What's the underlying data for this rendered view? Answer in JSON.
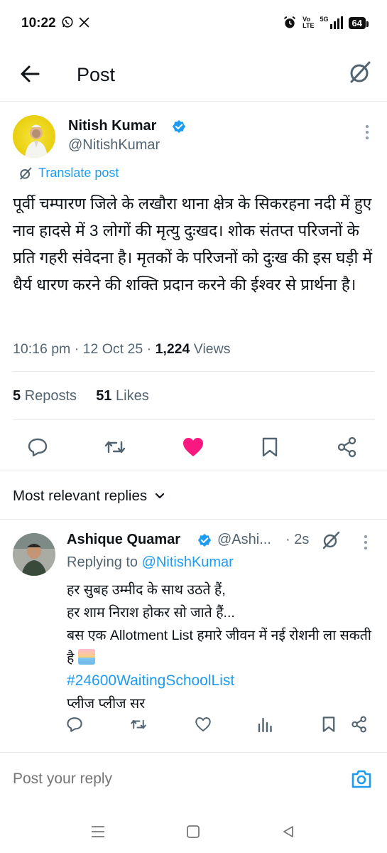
{
  "status_bar": {
    "time": "10:22",
    "left_icons": [
      "whatsapp-icon",
      "x-logo-icon"
    ],
    "network_top": "Vo",
    "network_bottom": "LTE",
    "signal": "5G",
    "battery": "64"
  },
  "header": {
    "title": "Post",
    "back_icon": "arrow-left-icon",
    "grok_icon": "grok-icon"
  },
  "post": {
    "author_name": "Nitish Kumar",
    "author_handle": "@NitishKumar",
    "translate_label": "Translate post",
    "text": "पूर्वी चम्पारण जिले के लखौरा थाना क्षेत्र के सिकरहना नदी में हुए नाव हादसे में 3 लोगों की मृत्यु दुःखद। शोक संतप्त परिजनों के प्रति गहरी संवेदना है। मृतकों के परिजनों को दुःख की इस घड़ी में धैर्य धारण करने की शक्ति प्रदान करने की ईश्वर से प्रार्थना है।",
    "time": "10:16 pm",
    "date": "12 Oct 25",
    "views_count": "1,224",
    "views_label": "Views",
    "reposts_count": "5",
    "reposts_label": "Reposts",
    "likes_count": "51",
    "likes_label": "Likes",
    "like_color": "#f91880"
  },
  "replies_section": {
    "sort_label": "Most relevant replies"
  },
  "reply": {
    "author_name": "Ashique Quamar",
    "author_handle": "@Ashi...",
    "time": "· 2s",
    "replying_prefix": "Replying to",
    "replying_handle": "@NitishKumar",
    "line1": "हर सुबह उम्मीद के साथ उठते हैं,",
    "line2": "हर शाम निराश होकर सो जाते हैं...",
    "line3": "बस एक Allotment List हमारे जीवन में नई रोशनी ला सकती है",
    "hashtag": "#24600WaitingSchoolList",
    "line4": "प्लीज प्लीज सर"
  },
  "composer": {
    "placeholder": "Post your reply"
  },
  "colors": {
    "accent": "#1d9bf0",
    "secondary_text": "#536471",
    "divider": "#e6e9ec"
  }
}
